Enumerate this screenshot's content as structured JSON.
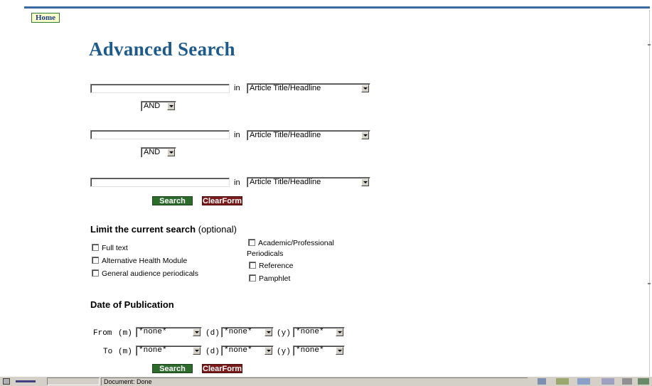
{
  "nav": {
    "home_label": "Home"
  },
  "page": {
    "title": "Advanced Search"
  },
  "search_rows": [
    {
      "term_value": "",
      "in_label": "in",
      "field_value": "Article Title/Headline",
      "operator": "AND"
    },
    {
      "term_value": "",
      "in_label": "in",
      "field_value": "Article Title/Headline",
      "operator": "AND"
    },
    {
      "term_value": "",
      "in_label": "in",
      "field_value": "Article Title/Headline"
    }
  ],
  "buttons": {
    "search_label": "Search",
    "clear_label": "ClearForm"
  },
  "limit": {
    "heading": "Limit the current search",
    "heading_optional": "(optional)",
    "left_options": [
      {
        "label": "Full text",
        "checked": false
      },
      {
        "label": "Alternative Health Module",
        "checked": false
      },
      {
        "label": "General audience periodicals",
        "checked": false
      }
    ],
    "right_options": [
      {
        "label": "Academic/Professional",
        "checked": false
      },
      {
        "label": "Periodicals"
      },
      {
        "label": "Reference",
        "checked": false
      },
      {
        "label": "Pamphlet",
        "checked": false
      }
    ]
  },
  "date": {
    "heading": "Date of Publication",
    "from_label": "From",
    "to_label": "To",
    "m_label": "(m)",
    "d_label": "(d)",
    "y_label": "(y)",
    "from": {
      "m": "*none*",
      "d": "*none*",
      "y": "*none*"
    },
    "to": {
      "m": "*none*",
      "d": "*none*",
      "y": "*none*"
    }
  },
  "statusbar": {
    "text": "Document: Done"
  },
  "colors": {
    "title": "#1e5a8a",
    "search_btn": "#2d6b2d",
    "clear_btn": "#7a1a1a",
    "top_line": "#3a6aa3"
  }
}
